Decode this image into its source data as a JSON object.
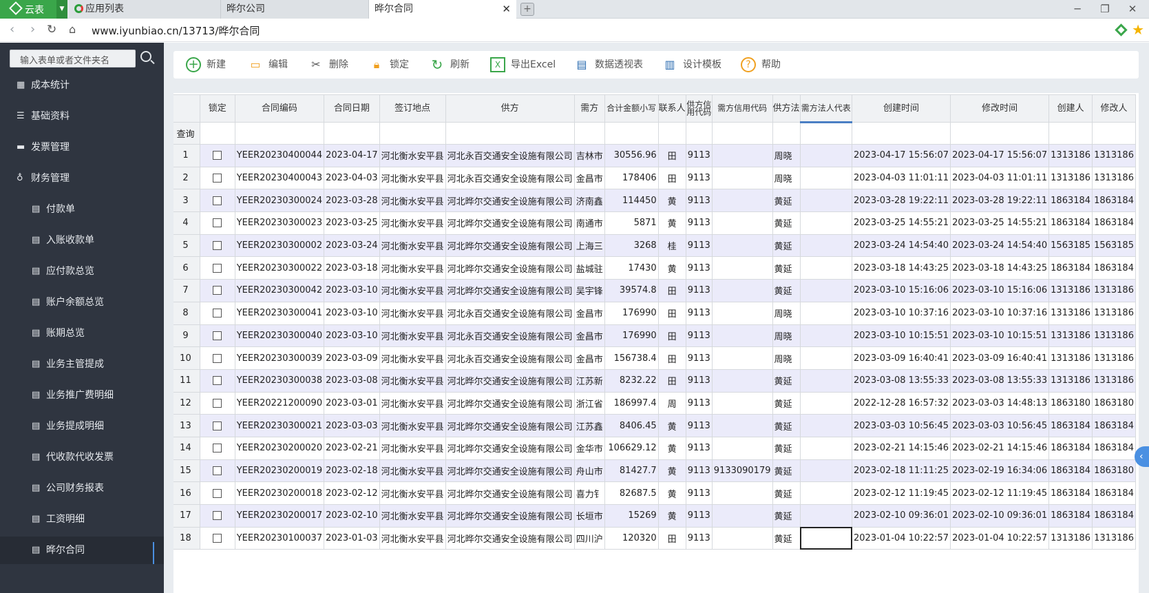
{
  "tabs": {
    "brand": "云表",
    "app_list": "应用列表",
    "company": "晔尔公司",
    "current": "晔尔合同",
    "close": "✕",
    "new_tab": "+"
  },
  "window": {
    "minimize": "─",
    "restore": "❐",
    "close": "✕"
  },
  "address": {
    "url": "www.iyunbiao.cn/13713/晔尔合同"
  },
  "sidebar": {
    "search_placeholder": "输入表单或者文件夹名",
    "items": [
      {
        "label": "成本统计",
        "icon": "chart-icon"
      },
      {
        "label": "基础资料",
        "icon": "list-icon"
      },
      {
        "label": "发票管理",
        "icon": "card-icon"
      },
      {
        "label": "财务管理",
        "icon": "money-bag-icon"
      },
      {
        "label": "付款单",
        "icon": "doc-icon"
      },
      {
        "label": "入账收款单",
        "icon": "doc-icon"
      },
      {
        "label": "应付款总览",
        "icon": "doc-icon"
      },
      {
        "label": "账户余额总览",
        "icon": "doc-icon"
      },
      {
        "label": "账期总览",
        "icon": "doc-icon"
      },
      {
        "label": "业务主管提成",
        "icon": "doc-icon"
      },
      {
        "label": "业务推广费明细",
        "icon": "doc-icon"
      },
      {
        "label": "业务提成明细",
        "icon": "doc-icon"
      },
      {
        "label": "代收款代收发票",
        "icon": "doc-icon"
      },
      {
        "label": "公司财务报表",
        "icon": "doc-icon"
      },
      {
        "label": "工资明细",
        "icon": "doc-icon"
      },
      {
        "label": "晔尔合同",
        "icon": "doc-icon"
      }
    ]
  },
  "toolbar": {
    "new": "新建",
    "edit": "编辑",
    "delete": "删除",
    "lock": "锁定",
    "refresh": "刷新",
    "export": "导出Excel",
    "pivot": "数据透视表",
    "design": "设计模板",
    "help": "帮助"
  },
  "table": {
    "headers": [
      "锁定",
      "合同编码",
      "合同日期",
      "签订地点",
      "供方",
      "需方",
      "合计金额小写",
      "联系人",
      "供方信用代码",
      "需方信用代码",
      "供方法",
      "需方法人代表",
      "创建时间",
      "修改时间",
      "创建人",
      "修改人"
    ],
    "filter_label": "查询",
    "rows": [
      [
        "1",
        "YEER20230400044",
        "2023-04-17",
        "河北衡水安平县",
        "河北永百交通安全设施有限公司",
        "吉林市",
        "30556.96",
        "田",
        "9113",
        "",
        "周晓",
        "",
        "2023-04-17 15:56:07",
        "2023-04-17 15:56:07",
        "1313186",
        "1313186"
      ],
      [
        "2",
        "YEER20230400043",
        "2023-04-03",
        "河北衡水安平县",
        "河北永百交通安全设施有限公司",
        "金昌市",
        "178406",
        "田",
        "9113",
        "",
        "周晓",
        "",
        "2023-04-03 11:01:11",
        "2023-04-03 11:01:11",
        "1313186",
        "1313186"
      ],
      [
        "3",
        "YEER20230300024",
        "2023-03-28",
        "河北衡水安平县",
        "河北晔尔交通安全设施有限公司",
        "济南鑫",
        "114450",
        "黄",
        "9113",
        "",
        "黄延",
        "",
        "2023-03-28 19:22:11",
        "2023-03-28 19:22:11",
        "1863184",
        "1863184"
      ],
      [
        "4",
        "YEER20230300023",
        "2023-03-25",
        "河北衡水安平县",
        "河北晔尔交通安全设施有限公司",
        "南通市",
        "5871",
        "黄",
        "9113",
        "",
        "黄延",
        "",
        "2023-03-25 14:55:21",
        "2023-03-25 14:55:21",
        "1863184",
        "1863184"
      ],
      [
        "5",
        "YEER20230300002",
        "2023-03-24",
        "河北衡水安平县",
        "河北晔尔交通安全设施有限公司",
        "上海三",
        "3268",
        "桂",
        "9113",
        "",
        "黄延",
        "",
        "2023-03-24 14:54:40",
        "2023-03-24 14:54:40",
        "1563185",
        "1563185"
      ],
      [
        "6",
        "YEER20230300022",
        "2023-03-18",
        "河北衡水安平县",
        "河北晔尔交通安全设施有限公司",
        "盐城驻",
        "17430",
        "黄",
        "9113",
        "",
        "黄延",
        "",
        "2023-03-18 14:43:25",
        "2023-03-18 14:43:25",
        "1863184",
        "1863184"
      ],
      [
        "7",
        "YEER20230300042",
        "2023-03-10",
        "河北衡水安平县",
        "河北晔尔交通安全设施有限公司",
        "吴宇锋",
        "39574.8",
        "田",
        "9113",
        "",
        "黄延",
        "",
        "2023-03-10 15:16:06",
        "2023-03-10 15:16:06",
        "1313186",
        "1313186"
      ],
      [
        "8",
        "YEER20230300041",
        "2023-03-10",
        "河北衡水安平县",
        "河北永百交通安全设施有限公司",
        "金昌市",
        "176990",
        "田",
        "9113",
        "",
        "周晓",
        "",
        "2023-03-10 10:37:16",
        "2023-03-10 10:37:16",
        "1313186",
        "1313186"
      ],
      [
        "9",
        "YEER20230300040",
        "2023-03-10",
        "河北衡水安平县",
        "河北永百交通安全设施有限公司",
        "金昌市",
        "176990",
        "田",
        "9113",
        "",
        "周晓",
        "",
        "2023-03-10 10:15:51",
        "2023-03-10 10:15:51",
        "1313186",
        "1313186"
      ],
      [
        "10",
        "YEER20230300039",
        "2023-03-09",
        "河北衡水安平县",
        "河北永百交通安全设施有限公司",
        "金昌市",
        "156738.4",
        "田",
        "9113",
        "",
        "周晓",
        "",
        "2023-03-09 16:40:41",
        "2023-03-09 16:40:41",
        "1313186",
        "1313186"
      ],
      [
        "11",
        "YEER20230300038",
        "2023-03-08",
        "河北衡水安平县",
        "河北晔尔交通安全设施有限公司",
        "江苏新",
        "8232.22",
        "田",
        "9113",
        "",
        "黄延",
        "",
        "2023-03-08 13:55:33",
        "2023-03-08 13:55:33",
        "1313186",
        "1313186"
      ],
      [
        "12",
        "YEER20221200090",
        "2023-03-01",
        "河北衡水安平县",
        "河北晔尔交通安全设施有限公司",
        "浙江省",
        "186997.4",
        "周",
        "9113",
        "",
        "黄延",
        "",
        "2022-12-28 16:57:32",
        "2023-03-03 14:48:13",
        "1863180",
        "1863180"
      ],
      [
        "13",
        "YEER20230300021",
        "2023-03-03",
        "河北衡水安平县",
        "河北晔尔交通安全设施有限公司",
        "江苏鑫",
        "8406.45",
        "黄",
        "9113",
        "",
        "黄延",
        "",
        "2023-03-03 10:56:45",
        "2023-03-03 10:56:45",
        "1863184",
        "1863184"
      ],
      [
        "14",
        "YEER20230200020",
        "2023-02-21",
        "河北衡水安平县",
        "河北晔尔交通安全设施有限公司",
        "金华市",
        "106629.12",
        "黄",
        "9113",
        "",
        "黄延",
        "",
        "2023-02-21 14:15:46",
        "2023-02-21 14:15:46",
        "1863184",
        "1863184"
      ],
      [
        "15",
        "YEER20230200019",
        "2023-02-18",
        "河北衡水安平县",
        "河北晔尔交通安全设施有限公司",
        "舟山市",
        "81427.7",
        "黄",
        "9113",
        "9133090179",
        "黄延",
        "",
        "2023-02-18 11:11:25",
        "2023-02-19 16:34:06",
        "1863184",
        "1863180"
      ],
      [
        "16",
        "YEER20230200018",
        "2023-02-12",
        "河北衡水安平县",
        "河北晔尔交通安全设施有限公司",
        "喜力钅",
        "82687.5",
        "黄",
        "9113",
        "",
        "黄延",
        "",
        "2023-02-12 11:19:45",
        "2023-02-12 11:19:45",
        "1863184",
        "1863184"
      ],
      [
        "17",
        "YEER20230200017",
        "2023-02-10",
        "河北衡水安平县",
        "河北晔尔交通安全设施有限公司",
        "长垣市",
        "15269",
        "黄",
        "9113",
        "",
        "黄延",
        "",
        "2023-02-10 09:36:01",
        "2023-02-10 09:36:01",
        "1863184",
        "1863184"
      ],
      [
        "18",
        "YEER20230100037",
        "2023-01-03",
        "河北衡水安平县",
        "河北晔尔交通安全设施有限公司",
        "四川沪",
        "120320",
        "田",
        "9113",
        "",
        "黄延",
        "",
        "2023-01-04 10:22:57",
        "2023-01-04 10:22:57",
        "1313186",
        "1313186"
      ]
    ]
  },
  "collapse_arrow": "‹",
  "colors": {
    "brand": "#3aa64a",
    "sidebar": "#2f3540",
    "accent": "#4a90e2",
    "row_stripe": "#ebebfa"
  }
}
